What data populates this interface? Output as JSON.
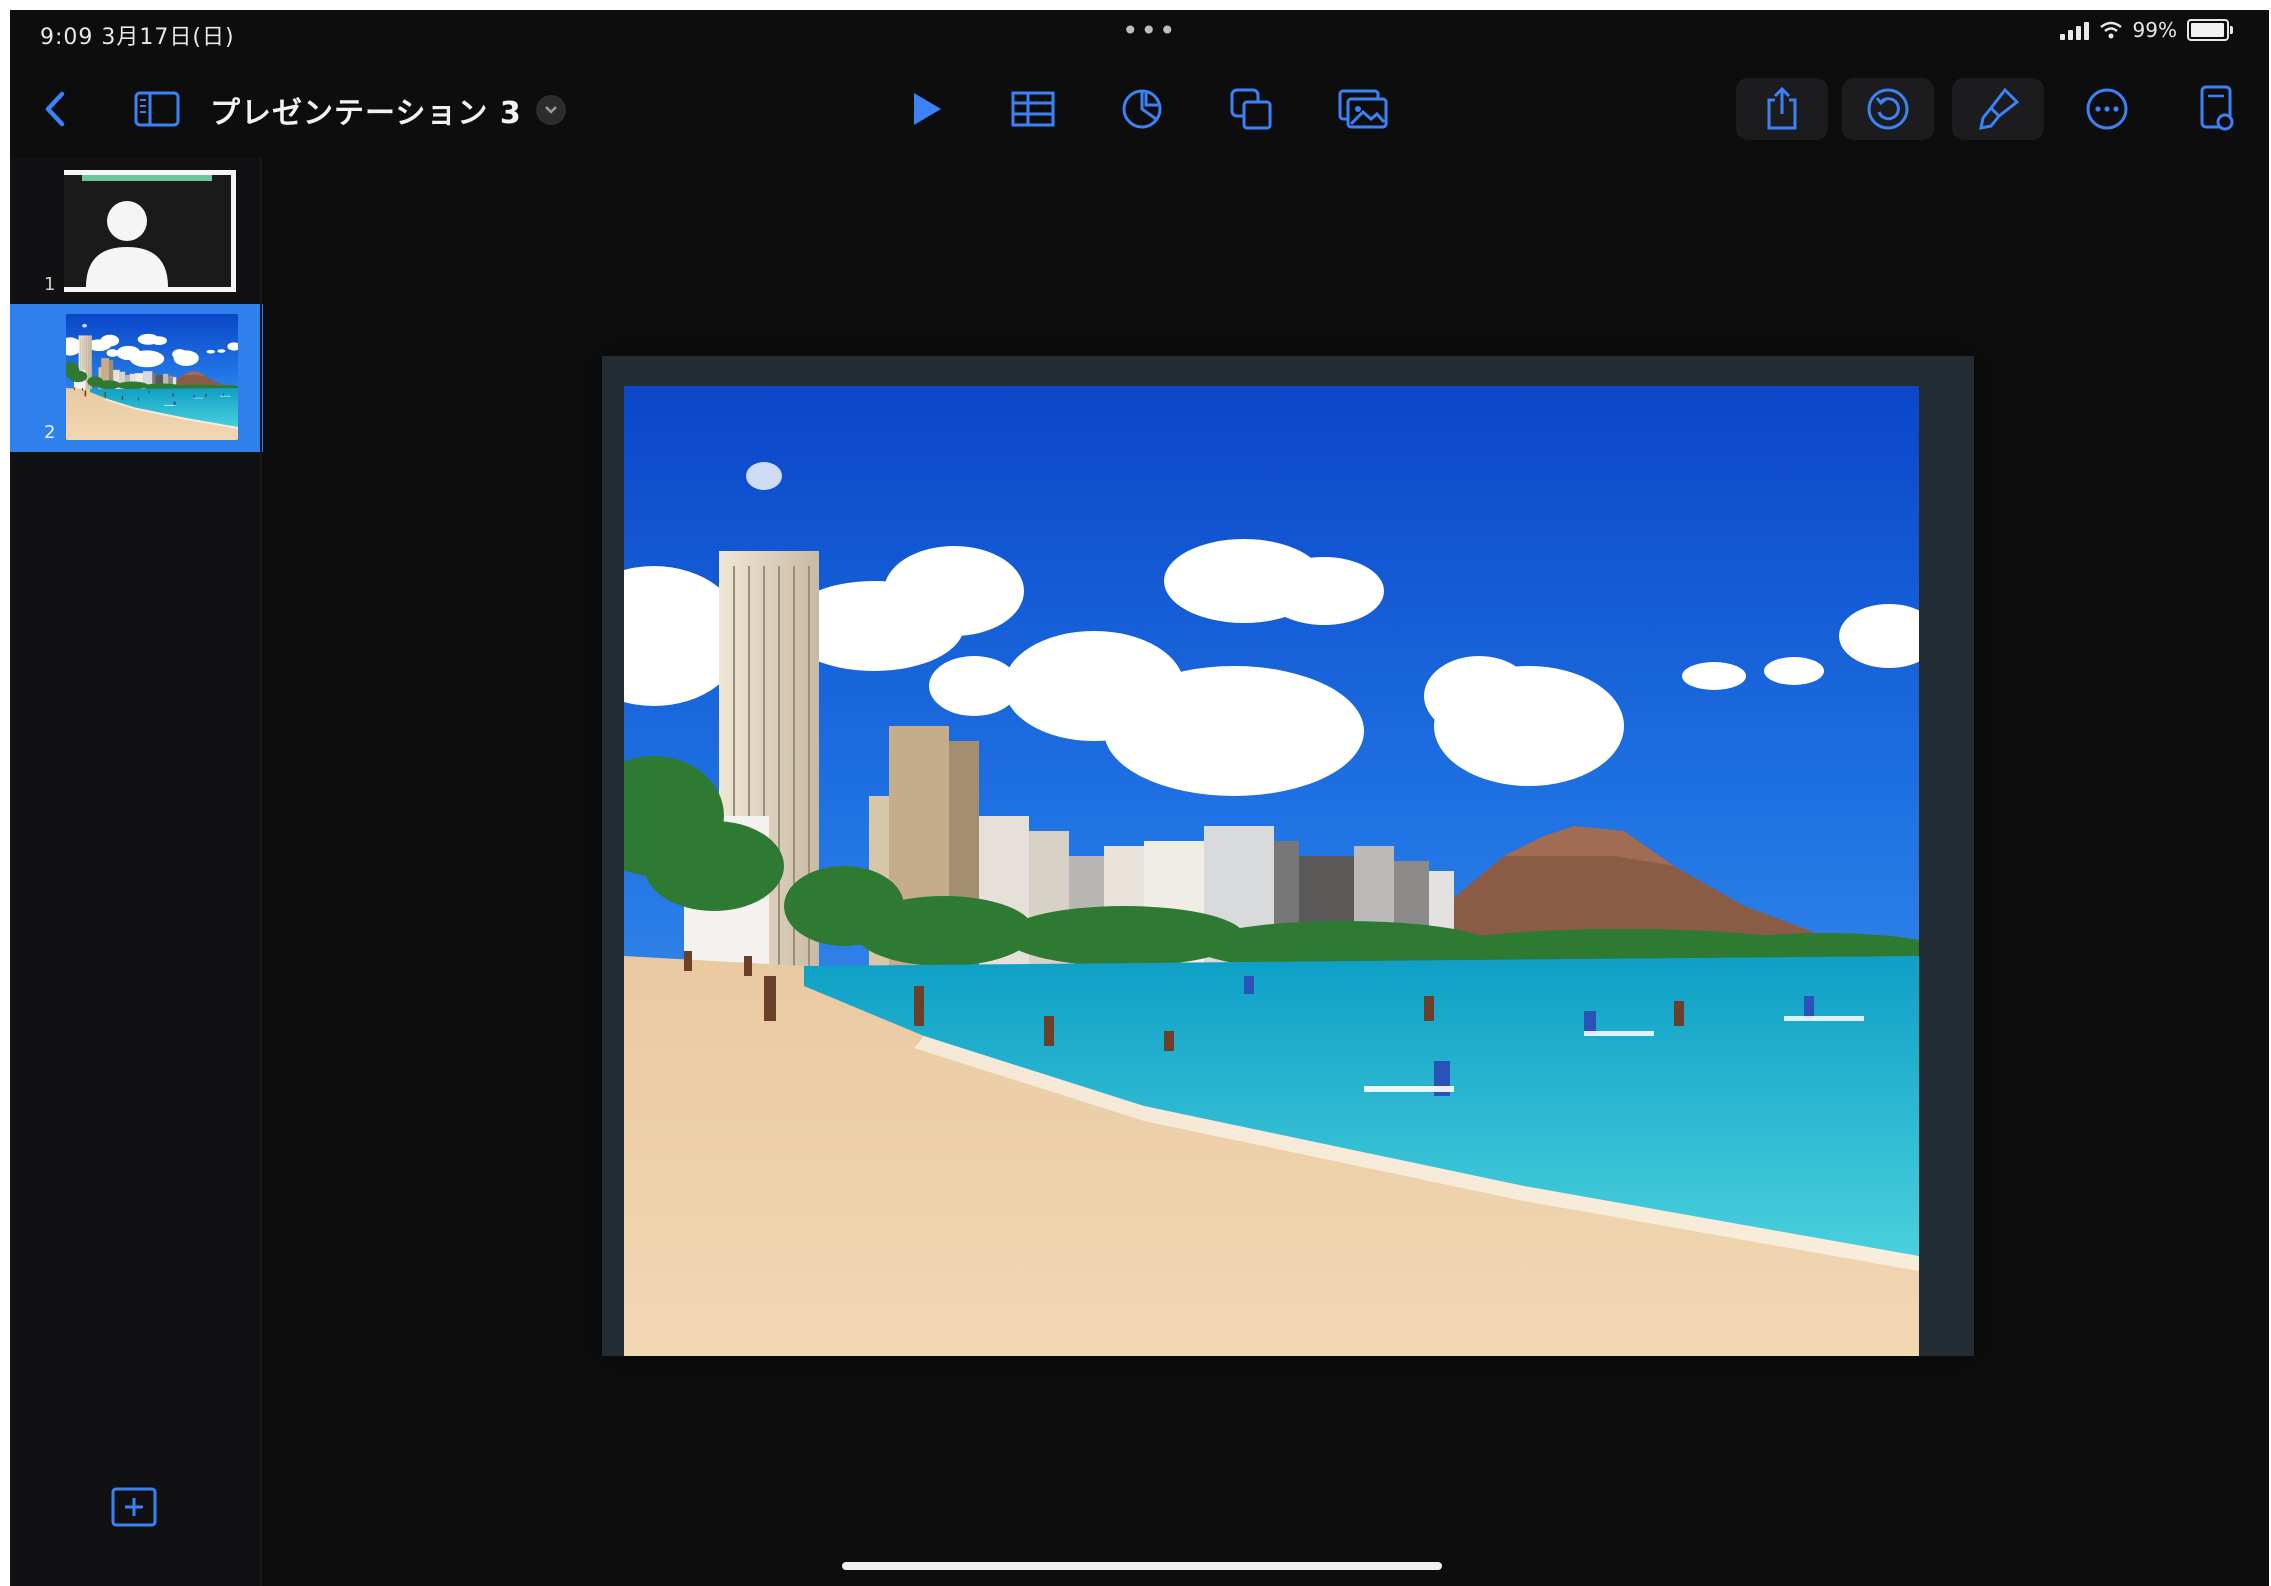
{
  "status_bar": {
    "time": "9:09  3月17日(日)",
    "battery": "99%"
  },
  "toolbar": {
    "title": "プレゼンテーション 3",
    "accent_color": "#3b82f6",
    "icons": [
      "back-chevron-icon",
      "sidebar-toggle-icon",
      "play-icon",
      "table-icon",
      "chart-icon",
      "shapes-icon",
      "media-icon",
      "share-icon",
      "undo-icon",
      "format-brush-icon",
      "more-icon",
      "document-icon"
    ]
  },
  "slides": [
    {
      "number": "1",
      "type": "title-placeholder"
    },
    {
      "number": "2",
      "type": "beach-photo",
      "selected": true
    }
  ],
  "canvas": {
    "content": "beach-photo"
  }
}
